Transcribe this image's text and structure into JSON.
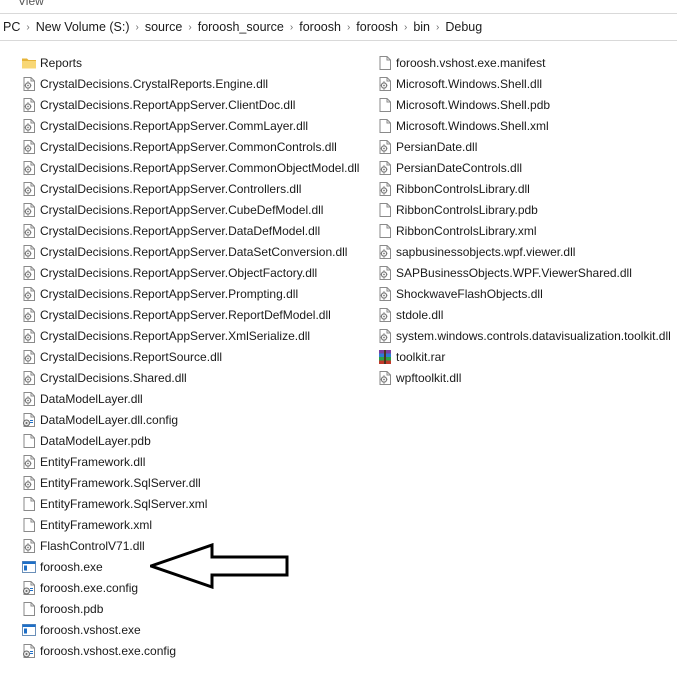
{
  "window": {
    "menu_label": "View"
  },
  "breadcrumb": [
    "PC",
    "New Volume (S:)",
    "source",
    "foroosh_source",
    "foroosh",
    "foroosh",
    "bin",
    "Debug"
  ],
  "files_col1": [
    {
      "name": "Reports",
      "icon": "folder"
    },
    {
      "name": "CrystalDecisions.CrystalReports.Engine.dll",
      "icon": "dll"
    },
    {
      "name": "CrystalDecisions.ReportAppServer.ClientDoc.dll",
      "icon": "dll"
    },
    {
      "name": "CrystalDecisions.ReportAppServer.CommLayer.dll",
      "icon": "dll"
    },
    {
      "name": "CrystalDecisions.ReportAppServer.CommonControls.dll",
      "icon": "dll"
    },
    {
      "name": "CrystalDecisions.ReportAppServer.CommonObjectModel.dll",
      "icon": "dll"
    },
    {
      "name": "CrystalDecisions.ReportAppServer.Controllers.dll",
      "icon": "dll"
    },
    {
      "name": "CrystalDecisions.ReportAppServer.CubeDefModel.dll",
      "icon": "dll"
    },
    {
      "name": "CrystalDecisions.ReportAppServer.DataDefModel.dll",
      "icon": "dll"
    },
    {
      "name": "CrystalDecisions.ReportAppServer.DataSetConversion.dll",
      "icon": "dll"
    },
    {
      "name": "CrystalDecisions.ReportAppServer.ObjectFactory.dll",
      "icon": "dll"
    },
    {
      "name": "CrystalDecisions.ReportAppServer.Prompting.dll",
      "icon": "dll"
    },
    {
      "name": "CrystalDecisions.ReportAppServer.ReportDefModel.dll",
      "icon": "dll"
    },
    {
      "name": "CrystalDecisions.ReportAppServer.XmlSerialize.dll",
      "icon": "dll"
    },
    {
      "name": "CrystalDecisions.ReportSource.dll",
      "icon": "dll"
    },
    {
      "name": "CrystalDecisions.Shared.dll",
      "icon": "dll"
    },
    {
      "name": "DataModelLayer.dll",
      "icon": "dll"
    },
    {
      "name": "DataModelLayer.dll.config",
      "icon": "config"
    },
    {
      "name": "DataModelLayer.pdb",
      "icon": "file"
    },
    {
      "name": "EntityFramework.dll",
      "icon": "dll"
    },
    {
      "name": "EntityFramework.SqlServer.dll",
      "icon": "dll"
    },
    {
      "name": "EntityFramework.SqlServer.xml",
      "icon": "file"
    },
    {
      "name": "EntityFramework.xml",
      "icon": "file"
    },
    {
      "name": "FlashControlV71.dll",
      "icon": "dll"
    },
    {
      "name": "foroosh.exe",
      "icon": "exe"
    },
    {
      "name": "foroosh.exe.config",
      "icon": "config"
    },
    {
      "name": "foroosh.pdb",
      "icon": "file"
    },
    {
      "name": "foroosh.vshost.exe",
      "icon": "exe"
    },
    {
      "name": "foroosh.vshost.exe.config",
      "icon": "config"
    }
  ],
  "files_col2": [
    {
      "name": "foroosh.vshost.exe.manifest",
      "icon": "file"
    },
    {
      "name": "Microsoft.Windows.Shell.dll",
      "icon": "dll"
    },
    {
      "name": "Microsoft.Windows.Shell.pdb",
      "icon": "file"
    },
    {
      "name": "Microsoft.Windows.Shell.xml",
      "icon": "file"
    },
    {
      "name": "PersianDate.dll",
      "icon": "dll"
    },
    {
      "name": "PersianDateControls.dll",
      "icon": "dll"
    },
    {
      "name": "RibbonControlsLibrary.dll",
      "icon": "dll"
    },
    {
      "name": "RibbonControlsLibrary.pdb",
      "icon": "file"
    },
    {
      "name": "RibbonControlsLibrary.xml",
      "icon": "file"
    },
    {
      "name": "sapbusinessobjects.wpf.viewer.dll",
      "icon": "dll"
    },
    {
      "name": "SAPBusinessObjects.WPF.ViewerShared.dll",
      "icon": "dll"
    },
    {
      "name": "ShockwaveFlashObjects.dll",
      "icon": "dll"
    },
    {
      "name": "stdole.dll",
      "icon": "dll"
    },
    {
      "name": "system.windows.controls.datavisualization.toolkit.dll",
      "icon": "dll"
    },
    {
      "name": "toolkit.rar",
      "icon": "rar"
    },
    {
      "name": "wpftoolkit.dll",
      "icon": "dll"
    }
  ],
  "colors": {
    "folder": "#f8d775",
    "folder_dark": "#e6b43a",
    "exe_blue": "#1e6fc7",
    "arrow": "#000000"
  }
}
